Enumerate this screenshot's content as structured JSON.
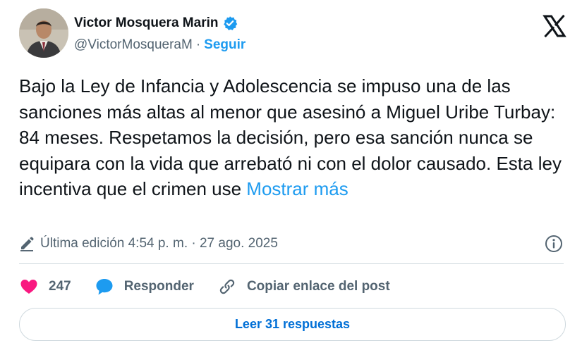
{
  "author": {
    "name": "Victor Mosquera Marin",
    "handle": "@VictorMosqueraM",
    "separator": "·",
    "follow_label": "Seguir"
  },
  "post": {
    "text": "Bajo la Ley de Infancia y Adolescencia se impuso una de las sanciones más altas al menor que asesinó a Miguel Uribe Turbay: 84 meses. Respetamos la decisión, pero esa sanción nunca se equipara con la vida que arrebató ni con el dolor causado. Esta ley incentiva que el crimen use",
    "show_more": "Mostrar más",
    "edited_meta": "Última edición 4:54 p. m. · 27 ago. 2025"
  },
  "actions": {
    "like_count": "247",
    "reply_label": "Responder",
    "copy_link_label": "Copiar enlace del post"
  },
  "replies_button": "Leer 31 respuestas",
  "colors": {
    "accent": "#1d9bf0",
    "like": "#f91880",
    "muted": "#536471",
    "link_button": "#006fd6"
  },
  "icons": [
    "verified-badge-icon",
    "x-logo-icon",
    "pencil-icon",
    "info-icon",
    "heart-icon",
    "reply-bubble-icon",
    "link-icon"
  ]
}
